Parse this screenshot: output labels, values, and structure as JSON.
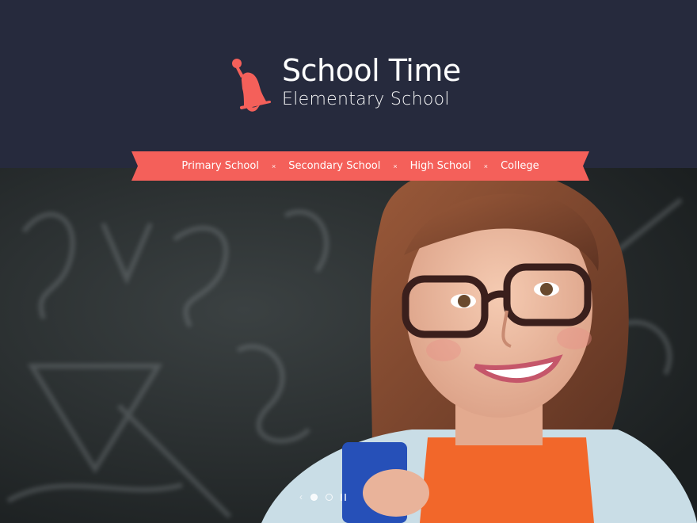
{
  "brand": {
    "title": "School Time",
    "subtitle": "Elementary School",
    "logo_icon": "bell-icon",
    "accent_color": "#f4605a",
    "header_bg": "#262a3d"
  },
  "nav": {
    "items": [
      {
        "label": "Primary School"
      },
      {
        "label": "Secondary School"
      },
      {
        "label": "High School"
      },
      {
        "label": "College"
      }
    ],
    "separator": "×"
  },
  "slider": {
    "prev_icon": "chevron-left-icon",
    "active_index": 0,
    "slide_count": 2,
    "pause_icon": "pause-icon",
    "image": "smiling-girl-with-glasses-and-backpack-in-front-of-chalkboard"
  }
}
